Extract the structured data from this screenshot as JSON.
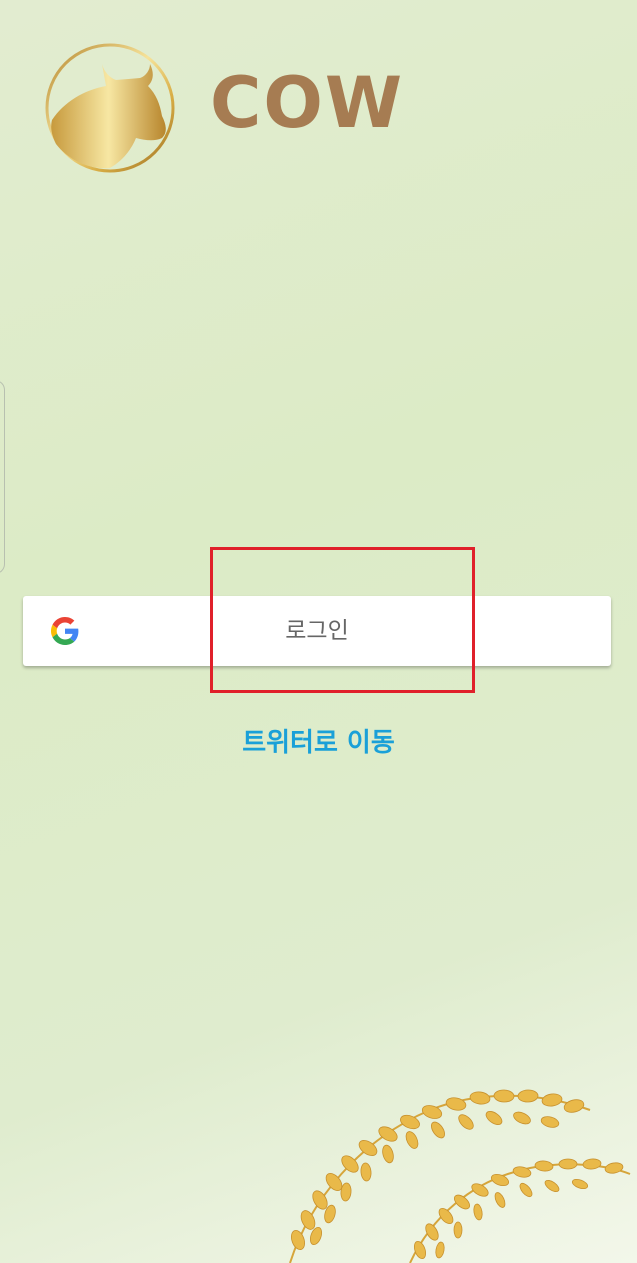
{
  "app": {
    "title": "COW"
  },
  "login": {
    "label": "로그인",
    "provider_icon": "google-g-icon"
  },
  "links": {
    "twitter": "트위터로 이동"
  },
  "colors": {
    "title_brown": "#a67c52",
    "link_blue": "#1aa0d8",
    "highlight_red": "#e0202a",
    "gold": "#d4a93b",
    "rice": "#e9b949"
  },
  "icons": {
    "logo": "cow-head-logo-icon",
    "decoration": "rice-stalk-illustration"
  }
}
